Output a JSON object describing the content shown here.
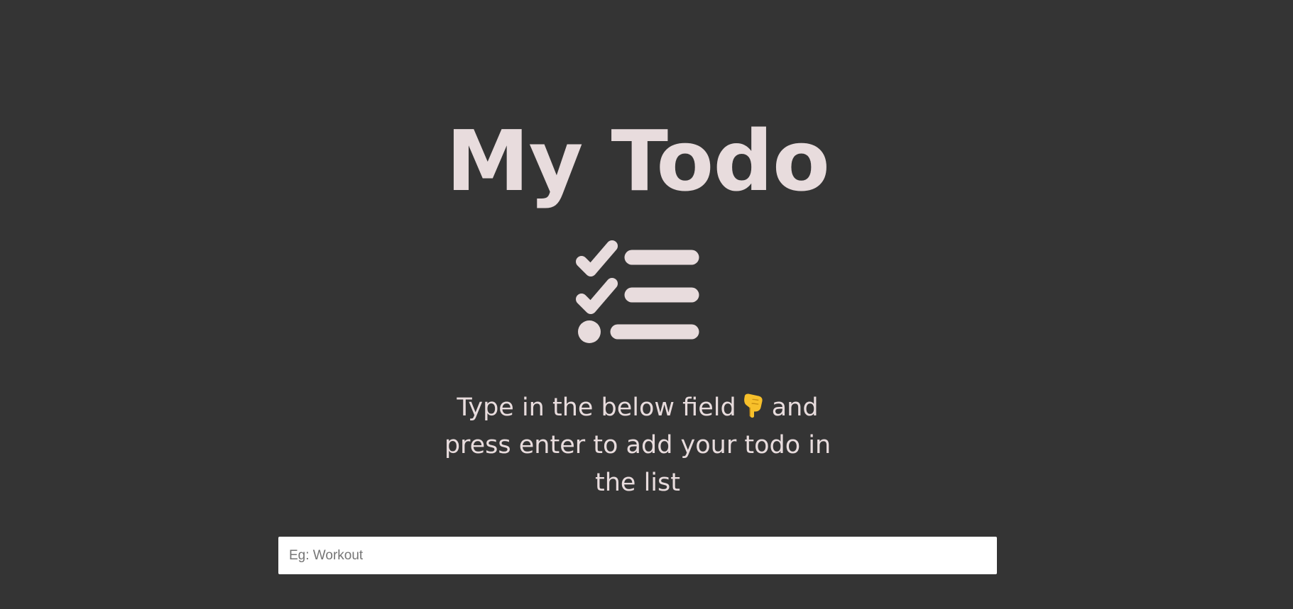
{
  "header": {
    "title": "My Todo",
    "icon": "checklist-icon"
  },
  "instructions": {
    "before_emoji": "Type in the below field",
    "emoji": "pointing-down-hand-icon",
    "after_emoji": "and press enter to add your todo in the list"
  },
  "todo_input": {
    "placeholder": "Eg: Workout",
    "value": ""
  },
  "colors": {
    "background": "#343434",
    "text": "#e8dcdd",
    "input_background": "#ffffff",
    "emoji": "#f7c02b"
  }
}
